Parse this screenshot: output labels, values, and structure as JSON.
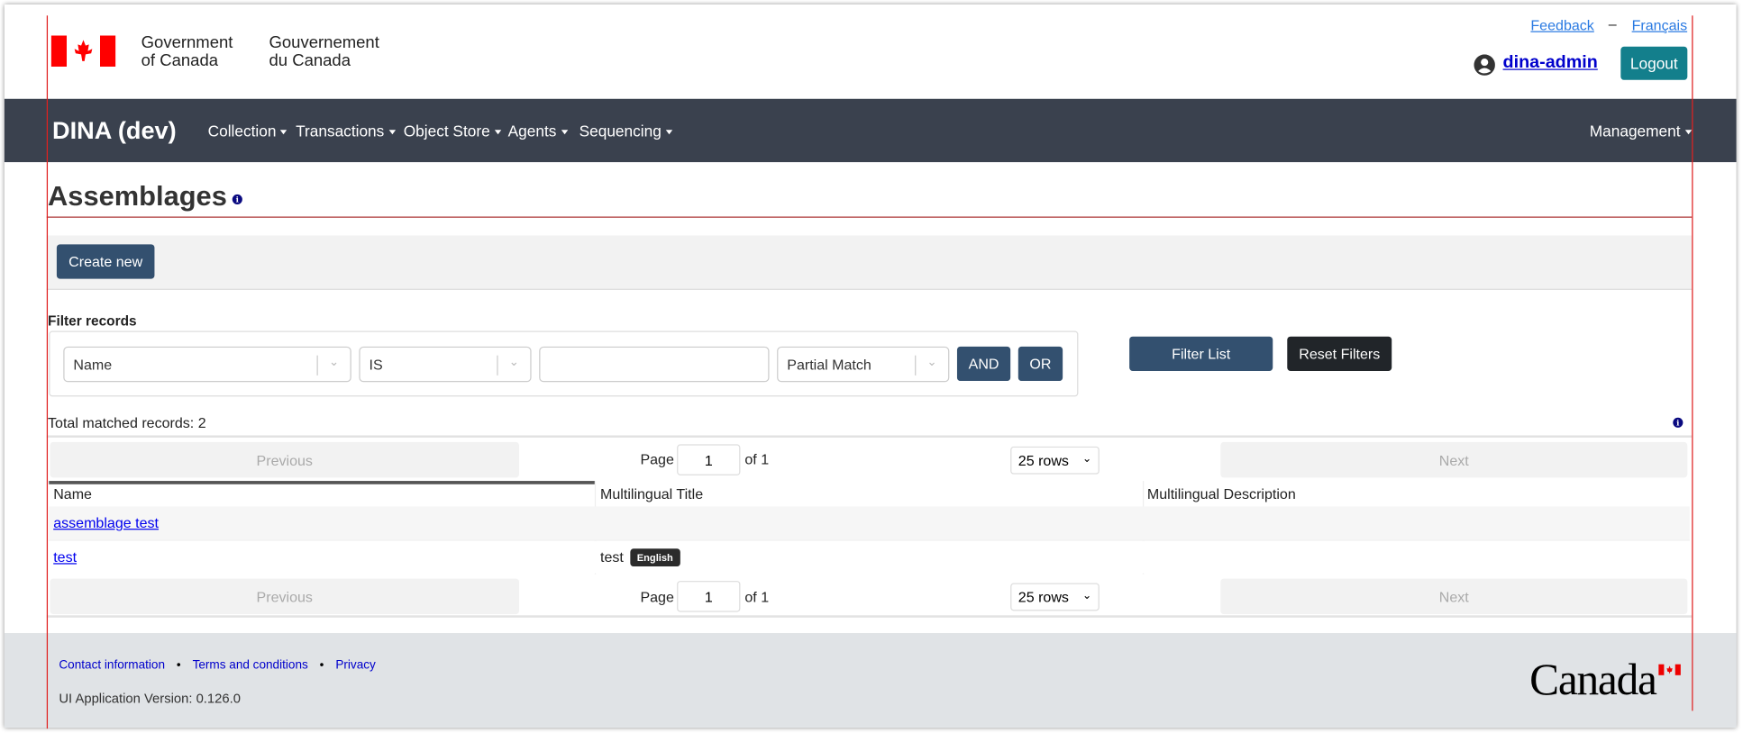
{
  "header": {
    "gov_en_line1": "Government",
    "gov_en_line2": "of Canada",
    "gov_fr_line1": "Gouvernement",
    "gov_fr_line2": "du Canada",
    "feedback_link": "Feedback",
    "separator": "–",
    "language_link": "Français",
    "username": "dina-admin",
    "logout_label": "Logout"
  },
  "nav": {
    "brand": "DINA (dev)",
    "items": [
      {
        "label": "Collection"
      },
      {
        "label": "Transactions"
      },
      {
        "label": "Object Store"
      },
      {
        "label": "Agents"
      },
      {
        "label": "Sequencing"
      }
    ],
    "right_item": "Management"
  },
  "page": {
    "title": "Assemblages",
    "create_new_label": "Create new"
  },
  "filter": {
    "heading": "Filter records",
    "field_value": "Name",
    "operator_value": "IS",
    "search_value": "",
    "match_value": "Partial Match",
    "and_label": "AND",
    "or_label": "OR",
    "filter_list_label": "Filter List",
    "reset_label": "Reset Filters"
  },
  "results": {
    "total_text": "Total matched records: 2"
  },
  "pagination": {
    "previous_label": "Previous",
    "page_label": "Page",
    "page_value": "1",
    "of_label": "of 1",
    "rows_value": "25 rows",
    "next_label": "Next"
  },
  "table": {
    "columns": [
      "Name",
      "Multilingual Title",
      "Multilingual Description"
    ],
    "rows": [
      {
        "name": "assemblage test",
        "title": "",
        "title_badge": "",
        "description": ""
      },
      {
        "name": "test",
        "title": "test",
        "title_badge": "English",
        "description": ""
      }
    ]
  },
  "footer": {
    "links": [
      "Contact information",
      "Terms and conditions",
      "Privacy"
    ],
    "bullet": "•",
    "version": "UI Application Version: 0.126.0",
    "wordmark": "Canada"
  },
  "colors": {
    "nav_bg": "#3a414e",
    "primary_button": "#33506f",
    "logout_button": "#137f8c",
    "dark_button": "#212529",
    "footer_bg": "#e0e3e6"
  }
}
